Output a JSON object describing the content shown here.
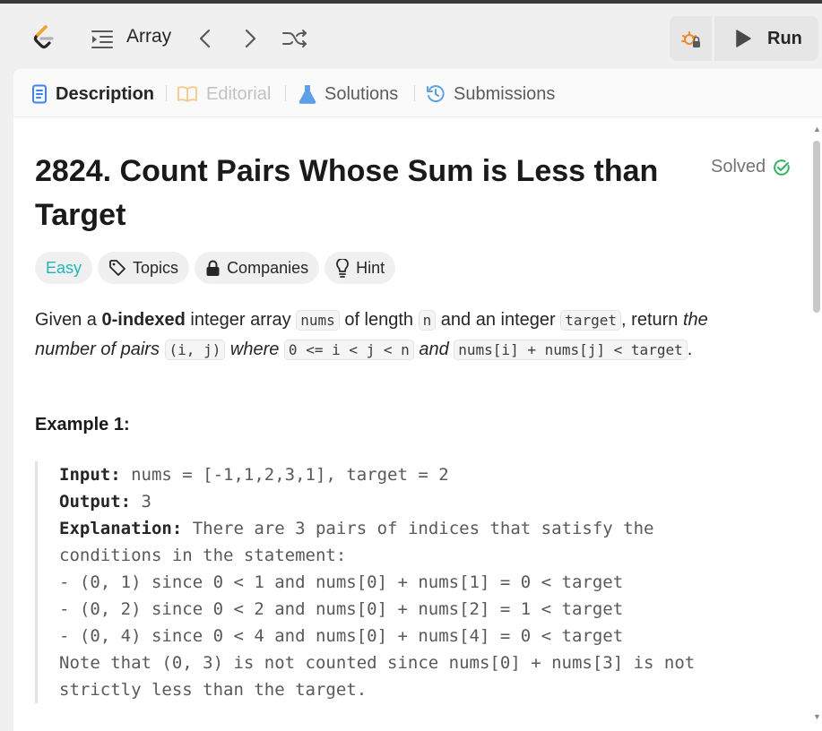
{
  "colors": {
    "accent_orange": "#ffa116",
    "easy_teal": "#1cb8b8",
    "solved_green": "#2db55d",
    "description_blue": "#3b82f6",
    "solutions_blue": "#5ba0e8"
  },
  "topbar": {
    "problem_list_label": "Array",
    "icons": [
      "leetcode-logo",
      "list-icon",
      "chevron-left-icon",
      "chevron-right-icon",
      "shuffle-icon",
      "debug-icon",
      "play-icon"
    ],
    "run_label": "Run"
  },
  "tabs": [
    {
      "label": "Description",
      "icon": "document-icon",
      "active": true
    },
    {
      "label": "Editorial",
      "icon": "book-icon",
      "disabled": true
    },
    {
      "label": "Solutions",
      "icon": "flask-icon"
    },
    {
      "label": "Submissions",
      "icon": "history-icon"
    }
  ],
  "problem": {
    "title": "2824. Count Pairs Whose Sum is Less than Target",
    "status": "Solved",
    "chips": {
      "difficulty": "Easy",
      "topics": "Topics",
      "companies": "Companies",
      "hint": "Hint"
    },
    "description": {
      "p1": "Given a ",
      "b1": "0-indexed",
      "p2": " integer array ",
      "c1": "nums",
      "p3": " of length ",
      "c2": "n",
      "p4": " and an integer ",
      "c3": "target",
      "p5": ", return ",
      "i1": "the number of pairs",
      "p6": " ",
      "c4": "(i, j)",
      "i2": " where ",
      "c5": "0 <= i < j < n",
      "i3": " and ",
      "c6": "nums[i] + nums[j] < target",
      "p7": "."
    },
    "example": {
      "title": "Example 1:",
      "input_label": "Input:",
      "input_value": " nums = [-1,1,2,3,1], target = 2",
      "output_label": "Output:",
      "output_value": " 3",
      "explanation_label": "Explanation:",
      "explanation_first": " There are 3 pairs of indices that satisfy the",
      "lines": [
        "conditions in the statement:",
        "- (0, 1) since 0 < 1 and nums[0] + nums[1] = 0 < target",
        "- (0, 2) since 0 < 2 and nums[0] + nums[2] = 1 < target",
        "- (0, 4) since 0 < 4 and nums[0] + nums[4] = 0 < target",
        "Note that (0, 3) is not counted since nums[0] + nums[3] is not",
        "strictly less than the target."
      ]
    }
  }
}
